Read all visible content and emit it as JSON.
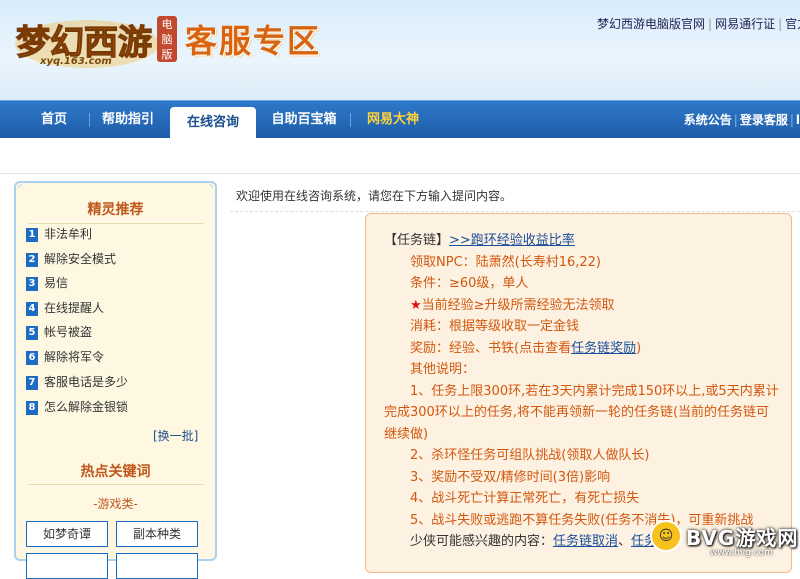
{
  "header": {
    "logo_text": "梦幻西游",
    "logo_sub": "xyq.163.com",
    "pc_badge": "电脑版",
    "zone_title": "客服专区",
    "links": [
      "梦幻西游电脑版官网",
      "网易通行证",
      "官方"
    ]
  },
  "nav": {
    "items": [
      "首页",
      "帮助指引",
      "在线咨询",
      "自助百宝箱",
      "网易大神"
    ],
    "active_index": 2,
    "right": [
      "系统公告",
      "登录客服",
      "l"
    ]
  },
  "sidebar": {
    "title": "精灵推荐",
    "items": [
      {
        "num": "1",
        "label": "非法牟利"
      },
      {
        "num": "2",
        "label": "解除安全模式"
      },
      {
        "num": "3",
        "label": "易信"
      },
      {
        "num": "4",
        "label": "在线提醒人"
      },
      {
        "num": "5",
        "label": "帐号被盗"
      },
      {
        "num": "6",
        "label": "解除将军令"
      },
      {
        "num": "7",
        "label": "客服电话是多少"
      },
      {
        "num": "8",
        "label": "怎么解除金银锁"
      }
    ],
    "refresh_label": "[换一批]",
    "hot_title": "热点关键词",
    "category": "-游戏类-",
    "keywords": [
      "如梦奇谭",
      "副本种类"
    ]
  },
  "main": {
    "welcome": "欢迎使用在线咨询系统，请您在下方输入提问内容。",
    "answer": {
      "heading": "【任务链】",
      "heading_link": ">>跑环经验收益比率",
      "npc": "领取NPC：陆萧然(长寿村16,22)",
      "cond": "条件：≥60级，单人",
      "star": "★",
      "star_text": "当前经验≥升级所需经验无法领取",
      "cost": "消耗：根据等级收取一定金钱",
      "reward_prefix": "奖励：经验、书铁(点击查看",
      "reward_link": "任务链奖励",
      "reward_suffix": ")",
      "notes_title": "其他说明：",
      "note1": "1、任务上限300环,若在3天内累计完成150环以上,或5天内累计完成300环以上的任务,将不能再领新一轮的任务链(当前的任务链可继续做)",
      "note2": "2、杀环怪任务可组队挑战(领取人做队长)",
      "note3": "3、奖励不受双/精修时间(3倍)影响",
      "note4": "4、战斗死亡计算正常死亡，有死亡损失",
      "note5": "5、战斗失败或逃跑不算任务失败(任务不消失)，可重新挑战",
      "more_prefix": "少侠可能感兴趣的内容：",
      "more_link1": "任务链取消",
      "more_sep": "、",
      "more_link2": "任务链"
    }
  },
  "watermark": {
    "text": "BVG游戏网",
    "sub": "www.bvg.com"
  }
}
